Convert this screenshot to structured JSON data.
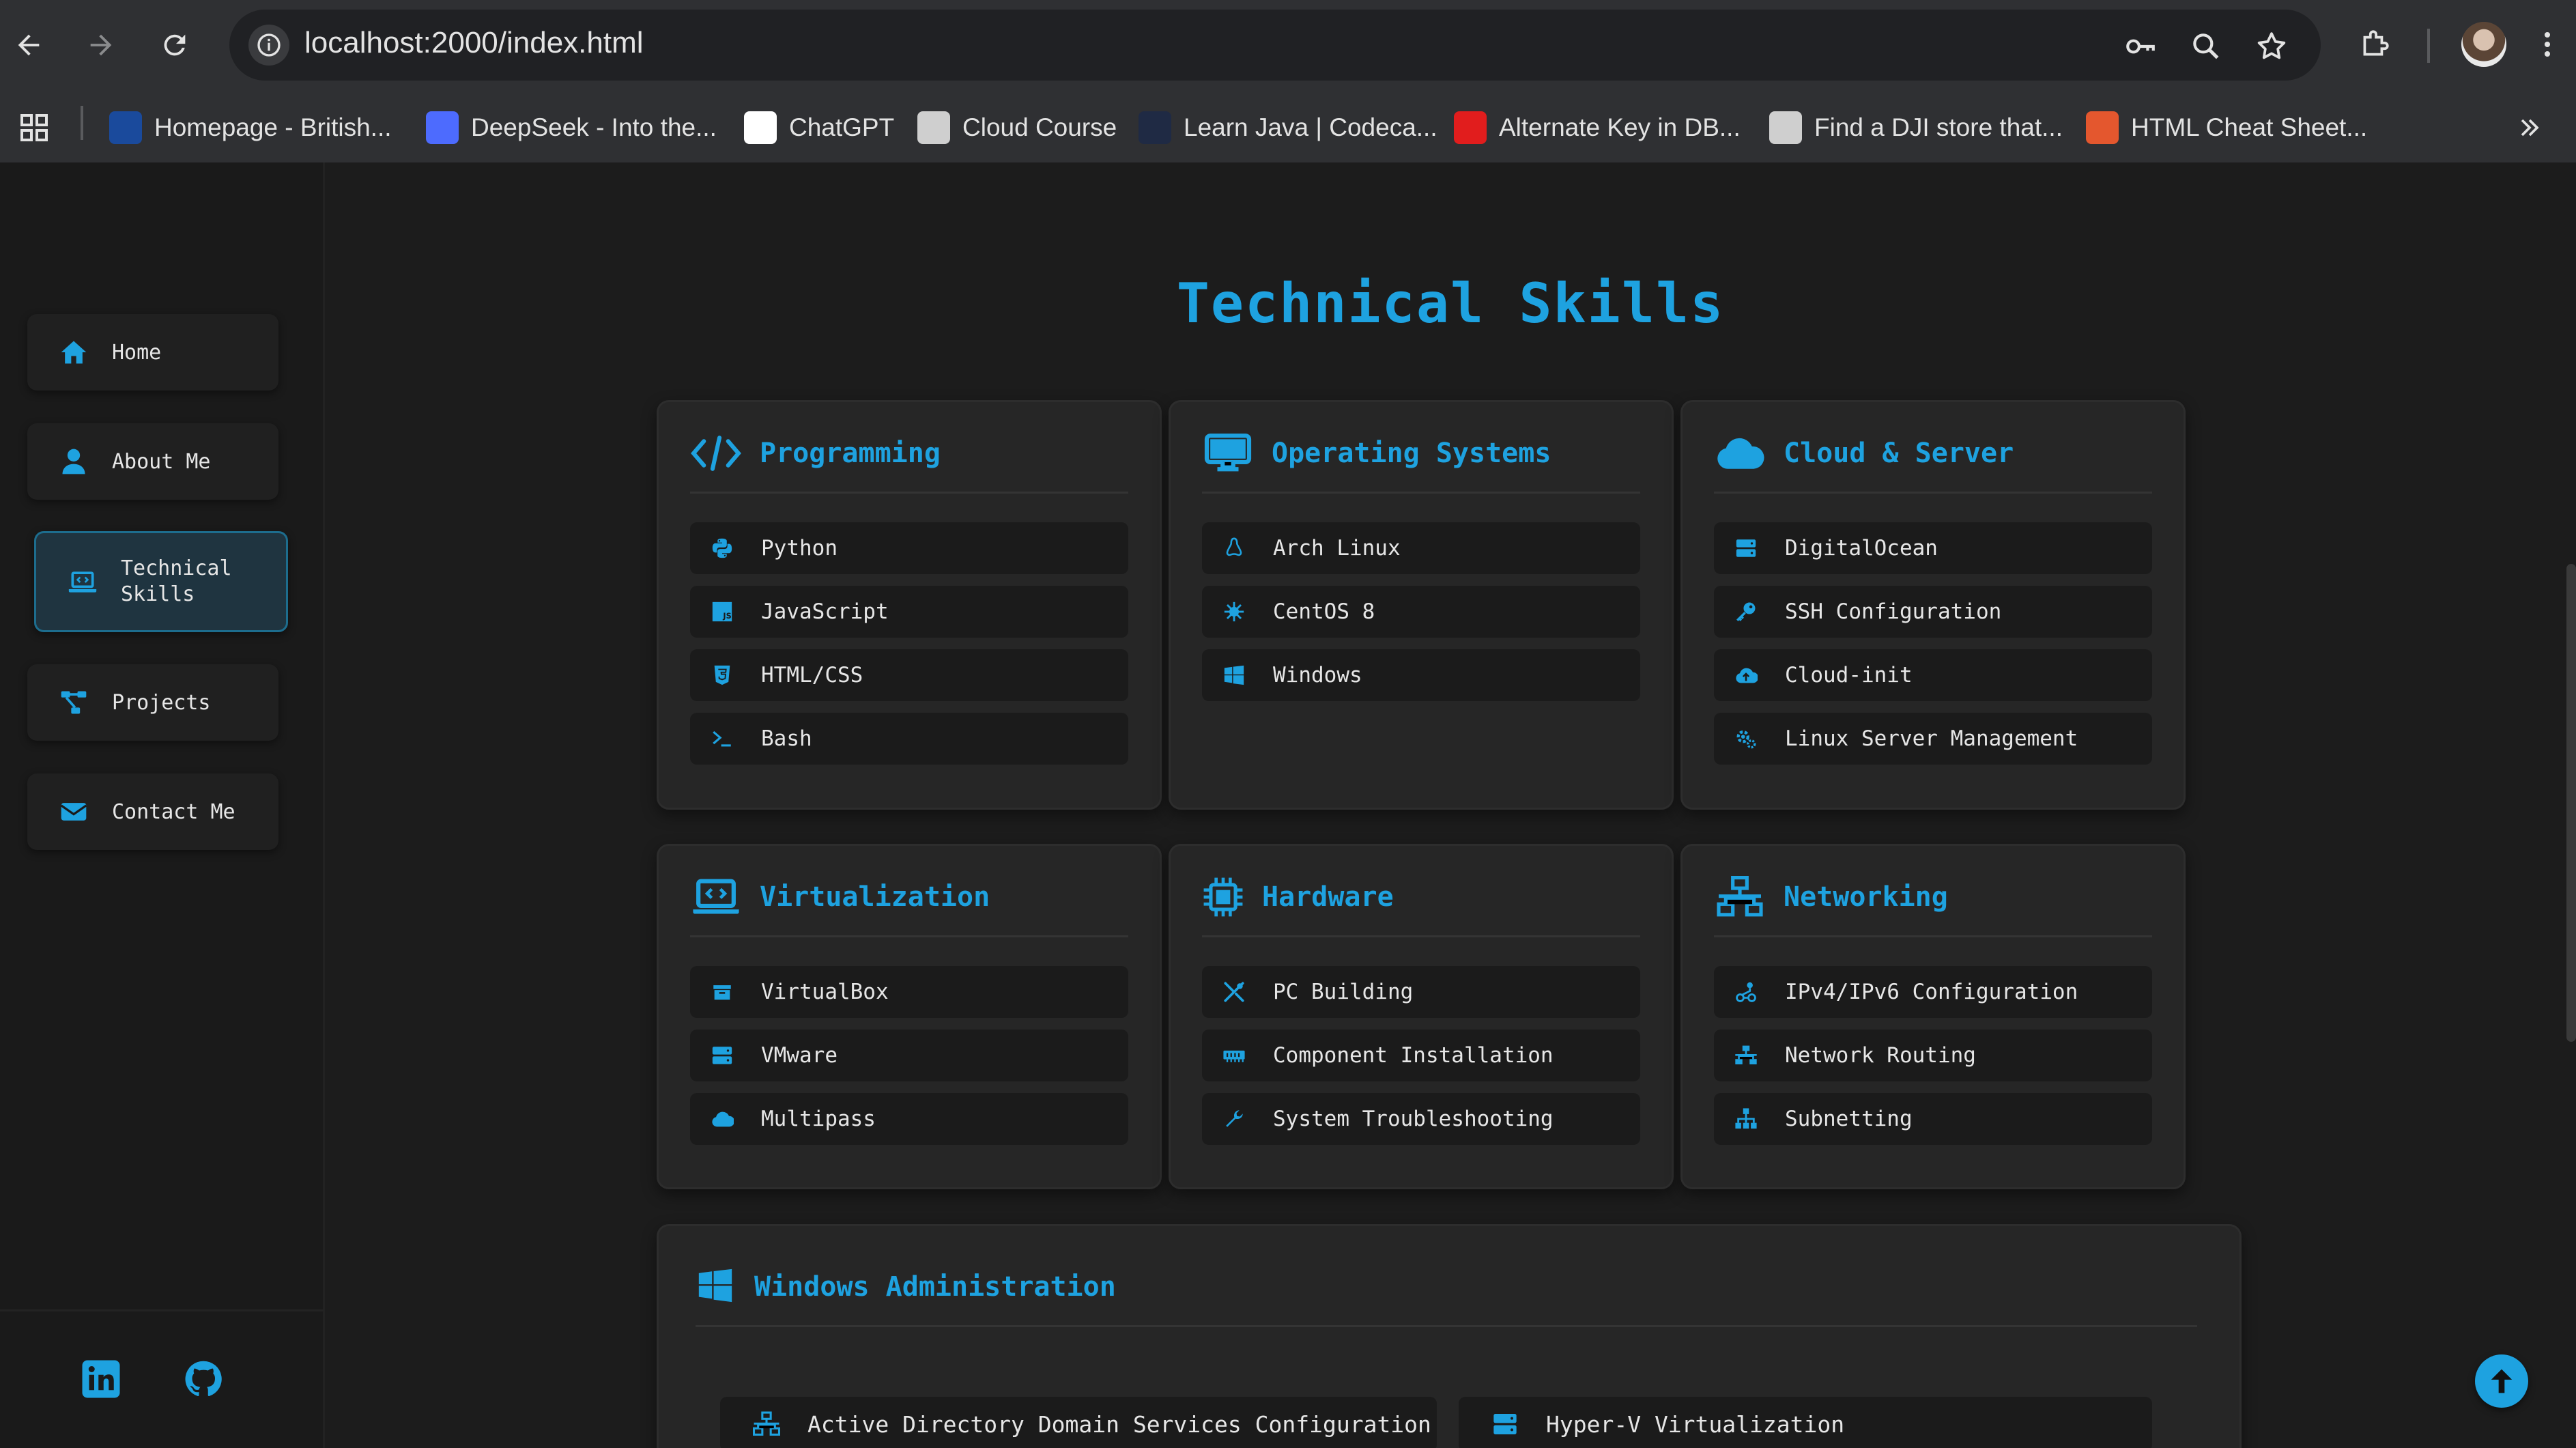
{
  "browser": {
    "url": "localhost:2000/index.html",
    "bookmarks": [
      {
        "label": "Homepage - British...",
        "icon": "bcit-icon",
        "color": "#1a4a9c"
      },
      {
        "label": "DeepSeek - Into the...",
        "icon": "deepseek-icon",
        "color": "#4d6bfe"
      },
      {
        "label": "ChatGPT",
        "icon": "chatgpt-icon",
        "color": "#ffffff"
      },
      {
        "label": "Cloud Course",
        "icon": "globe-icon",
        "color": "#cfcfcf"
      },
      {
        "label": "Learn Java | Codeca...",
        "icon": "codecademy-icon",
        "color": "#1f2a44"
      },
      {
        "label": "Alternate Key in DB...",
        "icon": "v-icon",
        "color": "#e11d1d"
      },
      {
        "label": "Find a DJI store that...",
        "icon": "dji-icon",
        "color": "#cfcfcf"
      },
      {
        "label": "HTML Cheat Sheet...",
        "icon": "html5-icon",
        "color": "#e4572e"
      }
    ]
  },
  "sidebar": {
    "items": [
      {
        "label": "Home",
        "icon": "home-icon"
      },
      {
        "label": "About Me",
        "icon": "user-icon"
      },
      {
        "label": "Technical Skills",
        "icon": "laptop-code-icon",
        "active": true
      },
      {
        "label": "Projects",
        "icon": "project-diagram-icon"
      },
      {
        "label": "Contact Me",
        "icon": "envelope-icon"
      }
    ],
    "social": [
      "linkedin-icon",
      "github-icon"
    ]
  },
  "main": {
    "title": "Technical Skills",
    "accent": "#1ea2e0",
    "cards": [
      {
        "title": "Programming",
        "icon": "code-icon",
        "skills": [
          {
            "label": "Python",
            "icon": "python-icon"
          },
          {
            "label": "JavaScript",
            "icon": "js-icon"
          },
          {
            "label": "HTML/CSS",
            "icon": "css3-icon"
          },
          {
            "label": "Bash",
            "icon": "terminal-icon"
          }
        ]
      },
      {
        "title": "Operating Systems",
        "icon": "desktop-icon",
        "skills": [
          {
            "label": "Arch Linux",
            "icon": "linux-icon"
          },
          {
            "label": "CentOS 8",
            "icon": "centos-icon"
          },
          {
            "label": "Windows",
            "icon": "windows-icon"
          }
        ]
      },
      {
        "title": "Cloud & Server",
        "icon": "cloud-icon",
        "skills": [
          {
            "label": "DigitalOcean",
            "icon": "server-icon"
          },
          {
            "label": "SSH Configuration",
            "icon": "key-icon"
          },
          {
            "label": "Cloud-init",
            "icon": "cloud-upload-icon"
          },
          {
            "label": "Linux Server Management",
            "icon": "cogs-icon"
          }
        ]
      },
      {
        "title": "Virtualization",
        "icon": "laptop-code-icon",
        "skills": [
          {
            "label": "VirtualBox",
            "icon": "box-icon"
          },
          {
            "label": "VMware",
            "icon": "server-icon"
          },
          {
            "label": "Multipass",
            "icon": "cloud-icon"
          }
        ]
      },
      {
        "title": "Hardware",
        "icon": "microchip-icon",
        "skills": [
          {
            "label": "PC Building",
            "icon": "tools-icon"
          },
          {
            "label": "Component Installation",
            "icon": "memory-icon"
          },
          {
            "label": "System Troubleshooting",
            "icon": "wrench-icon"
          }
        ]
      },
      {
        "title": "Networking",
        "icon": "network-icon",
        "skills": [
          {
            "label": "IPv4/IPv6 Configuration",
            "icon": "ethernet-icon"
          },
          {
            "label": "Network Routing",
            "icon": "network-icon"
          },
          {
            "label": "Subnetting",
            "icon": "sitemap-icon"
          }
        ]
      }
    ],
    "windows_admin": {
      "title": "Windows Administration",
      "icon": "windows-icon",
      "skills": [
        {
          "label": "Active Directory Domain Services Configuration",
          "icon": "network-icon"
        },
        {
          "label": "Hyper-V Virtualization",
          "icon": "server-icon"
        }
      ]
    }
  }
}
